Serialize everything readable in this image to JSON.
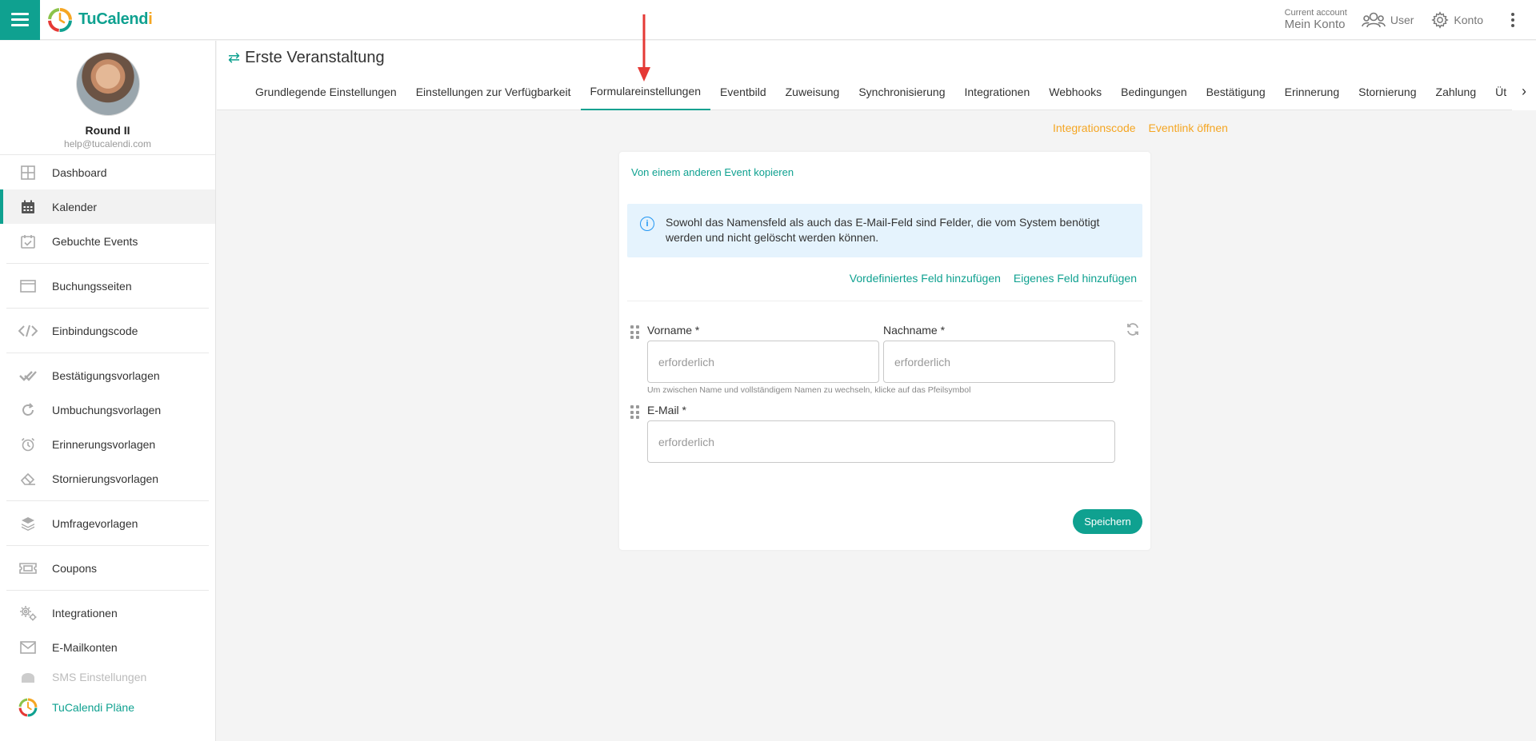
{
  "app": {
    "logo_main": "TuCalend",
    "logo_accent": "i"
  },
  "topbar": {
    "account_small": "Current account",
    "account_big": "Mein Konto",
    "user_label": "User",
    "konto_label": "Konto"
  },
  "profile": {
    "name": "Round II",
    "email": "help@tucalendi.com"
  },
  "sidebar": {
    "items": [
      {
        "label": "Dashboard",
        "icon": "dashboard-icon"
      },
      {
        "label": "Kalender",
        "icon": "calendar-icon",
        "active": true
      },
      {
        "label": "Gebuchte Events",
        "icon": "calendar-check-icon"
      },
      {
        "label": "Buchungsseiten",
        "icon": "browser-window-icon"
      },
      {
        "label": "Einbindungscode",
        "icon": "code-icon"
      },
      {
        "label": "Bestätigungsvorlagen",
        "icon": "double-check-icon"
      },
      {
        "label": "Umbuchungsvorlagen",
        "icon": "rotate-icon"
      },
      {
        "label": "Erinnerungsvorlagen",
        "icon": "alarm-clock-icon"
      },
      {
        "label": "Stornierungsvorlagen",
        "icon": "eraser-icon"
      },
      {
        "label": "Umfragevorlagen",
        "icon": "layers-icon"
      },
      {
        "label": "Coupons",
        "icon": "ticket-icon"
      },
      {
        "label": "Integrationen",
        "icon": "gears-icon"
      },
      {
        "label": "E-Mailkonten",
        "icon": "envelope-icon"
      },
      {
        "label": "SMS Einstellungen",
        "icon": "sms-icon"
      },
      {
        "label": "TuCalendi Pläne",
        "icon": "tucalendi-logo-icon"
      }
    ]
  },
  "header": {
    "title": "Erste Veranstaltung",
    "tabs": [
      {
        "label": "Grundlegende Einstellungen"
      },
      {
        "label": "Einstellungen zur Verfügbarkeit"
      },
      {
        "label": "Formulareinstellungen",
        "active": true
      },
      {
        "label": "Eventbild"
      },
      {
        "label": "Zuweisung"
      },
      {
        "label": "Synchronisierung"
      },
      {
        "label": "Integrationen"
      },
      {
        "label": "Webhooks"
      },
      {
        "label": "Bedingungen"
      },
      {
        "label": "Bestätigung"
      },
      {
        "label": "Erinnerung"
      },
      {
        "label": "Stornierung"
      },
      {
        "label": "Zahlung"
      },
      {
        "label": "Üt"
      }
    ]
  },
  "links": {
    "integration_code": "Integrationscode",
    "open_event_link": "Eventlink öffnen"
  },
  "form": {
    "copy_link": "Von einem anderen Event kopieren",
    "info_text_line1": "Sowohl das Namensfeld als auch das E-Mail-Feld sind Felder, die vom System benötigt",
    "info_text_line2": "werden und nicht gelöscht werden können.",
    "add_predefined": "Vordefiniertes Feld hinzufügen",
    "add_custom": "Eigenes Feld hinzufügen",
    "firstname_label": "Vorname *",
    "lastname_label": "Nachname *",
    "email_label": "E-Mail *",
    "placeholder": "erforderlich",
    "name_hint": "Um zwischen Name und vollständigem Namen zu wechseln, klicke auf das Pfeilsymbol",
    "save_label": "Speichern"
  },
  "colors": {
    "accent": "#0fa190",
    "brand_orange": "#f5a623",
    "info_bg": "#e5f3fd",
    "annotation_arrow": "#e53935"
  }
}
